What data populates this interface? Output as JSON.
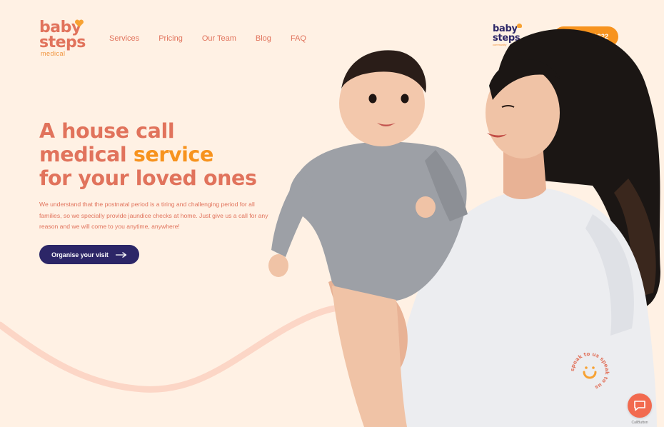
{
  "logo": {
    "line1": "baby",
    "line2": "steps",
    "line3": "medical"
  },
  "nav": {
    "items": [
      {
        "label": "Services"
      },
      {
        "label": "Pricing"
      },
      {
        "label": "Our Team"
      },
      {
        "label": "Blog"
      },
      {
        "label": "FAQ"
      }
    ]
  },
  "partner_logo": {
    "line1": "baby",
    "line2": "steps",
    "line3": "community"
  },
  "header": {
    "phone_label": "+65 8839 1322"
  },
  "hero": {
    "title_line1": "A house call",
    "title_line2_pre": "medical ",
    "title_line2_accent": "service",
    "title_line3": "for your loved ones",
    "description": "We understand that the postnatal period is a tiring and challenging period for all families, so we specially provide jaundice checks at home. Just give us a call for any reason and we will come to you anytime, anywhere!",
    "cta_label": "Organise your visit"
  },
  "speak_badge": {
    "text": "speak to us  speak to us"
  },
  "chat": {
    "label": "CallButton"
  },
  "colors": {
    "background": "#fff1e4",
    "coral": "#e1735c",
    "orange": "#f7931e",
    "navy": "#2c2667",
    "chat": "#f26a4f"
  },
  "icons": [
    "heart-icon",
    "arrow-right-icon",
    "smile-icon",
    "chat-icon"
  ]
}
